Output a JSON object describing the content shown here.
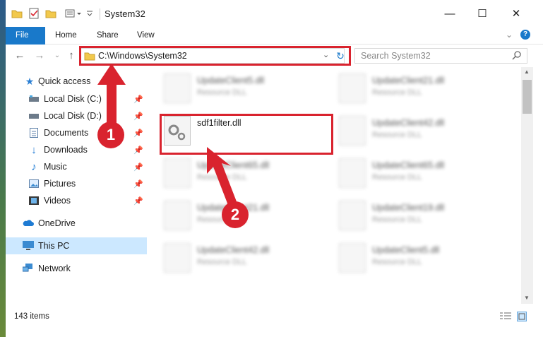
{
  "window": {
    "title": "System32",
    "minimize": "—",
    "maximize": "☐",
    "close": "✕"
  },
  "ribbon": {
    "tabs": [
      "File",
      "Home",
      "Share",
      "View"
    ]
  },
  "address": {
    "path": "C:\\Windows\\System32",
    "search_placeholder": "Search System32"
  },
  "nav": {
    "quick_access": "Quick access",
    "items": [
      {
        "label": "Local Disk (C:)",
        "icon": "drive-icon"
      },
      {
        "label": "Local Disk (D:)",
        "icon": "drive-icon"
      },
      {
        "label": "Documents",
        "icon": "documents-icon"
      },
      {
        "label": "Downloads",
        "icon": "downloads-icon"
      },
      {
        "label": "Music",
        "icon": "music-icon"
      },
      {
        "label": "Pictures",
        "icon": "pictures-icon"
      },
      {
        "label": "Videos",
        "icon": "videos-icon"
      }
    ],
    "onedrive": "OneDrive",
    "this_pc": "This PC",
    "network": "Network"
  },
  "files": {
    "left": [
      {
        "name": "UpdateClient5.dll",
        "type": "Resource DLL"
      },
      {
        "name": "sdf1filter.dll",
        "type": ""
      },
      {
        "name": "UpdateClient65.dll",
        "type": "Resource DLL"
      },
      {
        "name": "UpdateClient21.dll",
        "type": "Resource DLL"
      },
      {
        "name": "UpdateClient42.dll",
        "type": "Resource DLL"
      }
    ],
    "right": [
      {
        "name": "UpdateClient21.dll",
        "type": "Resource DLL"
      },
      {
        "name": "UpdateClient42.dll",
        "type": "Resource DLL"
      },
      {
        "name": "UpdateClient65.dll",
        "type": "Resource DLL"
      },
      {
        "name": "UpdateClient19.dll",
        "type": "Resource DLL"
      },
      {
        "name": "UpdateClient5.dll",
        "type": "Resource DLL"
      }
    ]
  },
  "status": {
    "item_count": "143 items"
  },
  "annotations": {
    "step1": "1",
    "step2": "2",
    "color": "#d9232e"
  }
}
